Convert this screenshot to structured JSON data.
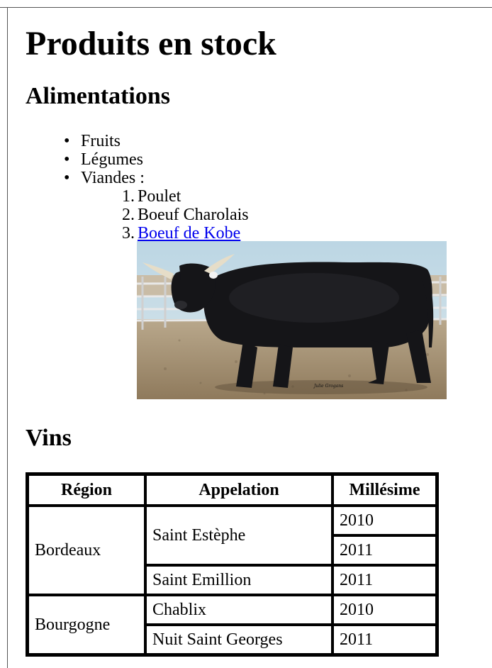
{
  "heading": "Produits en stock",
  "sections": {
    "alimentations": {
      "title": "Alimentations",
      "items": [
        "Fruits",
        "Légumes",
        "Viandes :"
      ],
      "viandes": [
        {
          "num": "1.",
          "label": "Poulet"
        },
        {
          "num": "2.",
          "label": "Boeuf Charolais"
        },
        {
          "num": "3.",
          "label": "Boeuf de Kobe"
        }
      ],
      "image": {
        "subject": "black-bull-photo",
        "signature": "Julie Grogans"
      }
    },
    "vins": {
      "title": "Vins",
      "table": {
        "headers": [
          "Région",
          "Appelation",
          "Millésime"
        ],
        "rows": [
          {
            "region": "Bordeaux",
            "appelation": "Saint Estèphe",
            "millesimes": [
              "2010",
              "2011"
            ]
          },
          {
            "appelation": "Saint Emillion",
            "millesime": "2011"
          },
          {
            "region": "Bourgogne",
            "appelation": "Chablix",
            "millesime": "2010"
          },
          {
            "appelation": "Nuit Saint Georges",
            "millesime": "2011"
          }
        ]
      }
    }
  }
}
